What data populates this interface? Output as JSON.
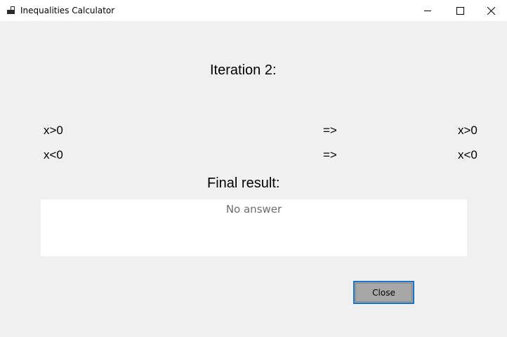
{
  "window": {
    "title": "Inequalities Calculator",
    "controls": {
      "minimize": "minimize-icon",
      "maximize": "maximize-icon",
      "close": "close-icon"
    }
  },
  "iteration": {
    "title": "Iteration 2:",
    "rows": [
      {
        "input": "x>0",
        "arrow": "=>",
        "output": "x>0"
      },
      {
        "input": "x<0",
        "arrow": "=>",
        "output": "x<0"
      }
    ]
  },
  "result": {
    "title": "Final result:",
    "value": "No answer"
  },
  "actions": {
    "close_label": "Close"
  },
  "colors": {
    "window_bg": "#f0f0f0",
    "titlebar_bg": "#ffffff",
    "button_bg": "#a7a7a7",
    "button_focus_border": "#1a73c8",
    "result_text": "#6d6d6d"
  }
}
